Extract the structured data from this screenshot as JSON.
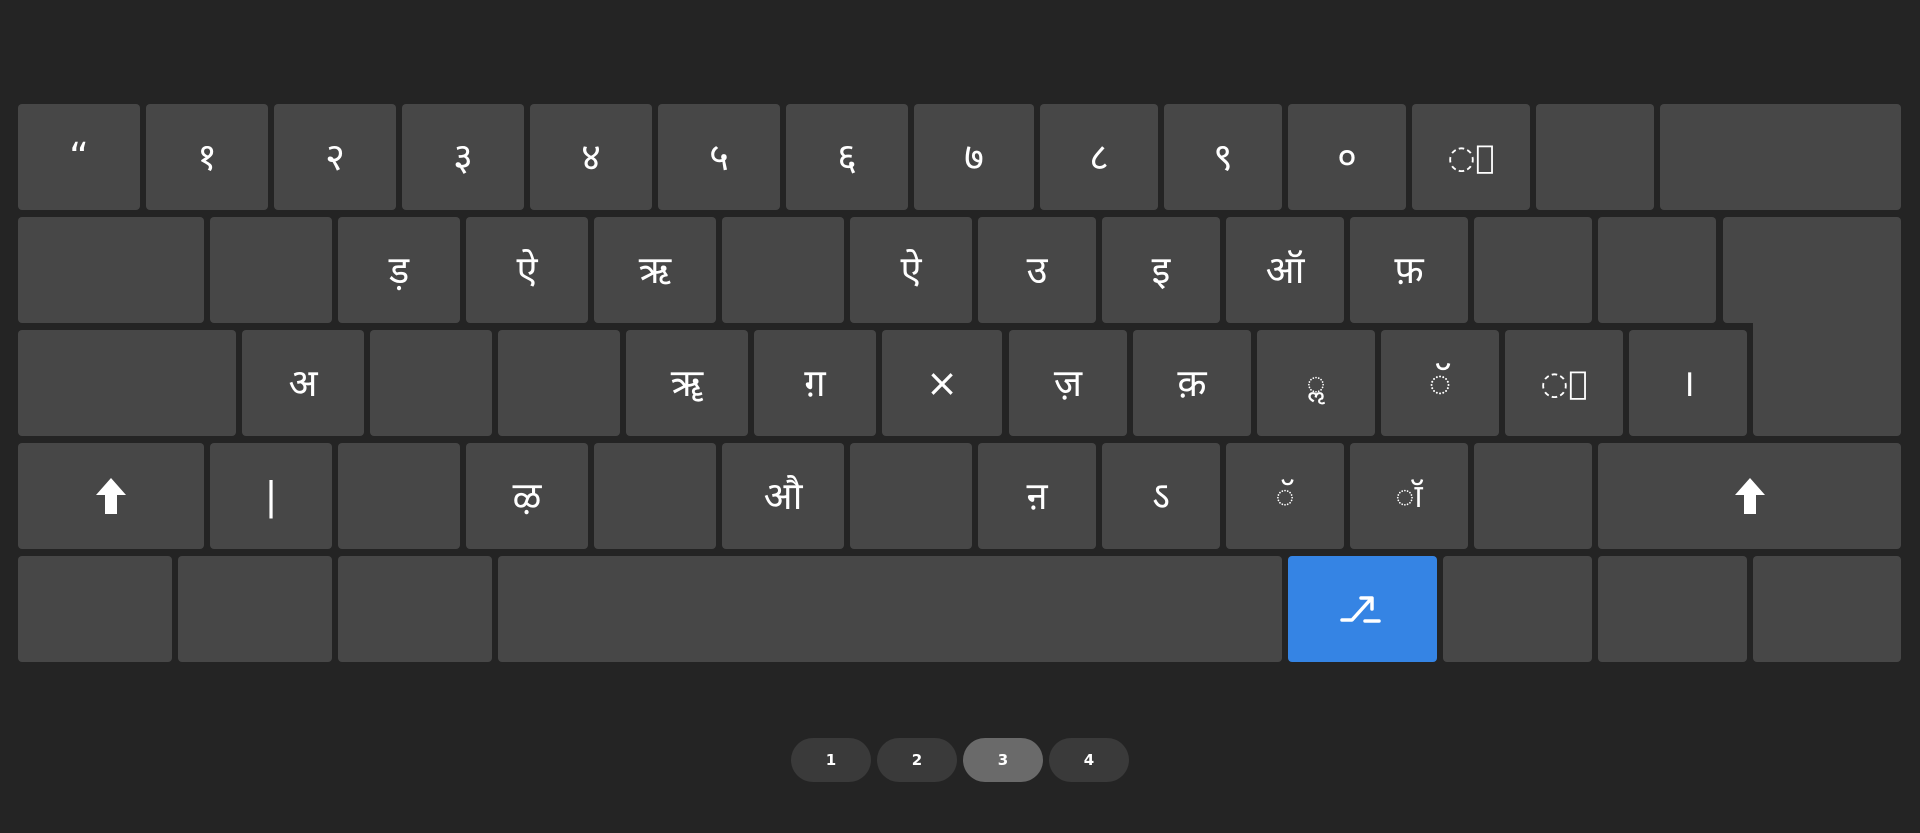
{
  "keyboard": {
    "row1": [
      "“",
      "१",
      "२",
      "३",
      "४",
      "५",
      "६",
      "७",
      "८",
      "९",
      "०",
      "◌॒",
      "",
      ""
    ],
    "row2": [
      "",
      "",
      "ड़",
      "ऐ",
      "ऋ",
      "",
      "ऐ",
      "उ",
      "इ",
      "ऑ",
      "फ़",
      "",
      "",
      ""
    ],
    "row3": [
      "",
      "अ",
      "",
      "",
      "ॠ",
      "ग़",
      "×",
      "ज़",
      "क़",
      "◌ॢ",
      "ॅ",
      "◌॑",
      "।"
    ],
    "row4": [
      "shift-icon",
      "|",
      "",
      "ऴ",
      "",
      "औ",
      "",
      "ऩ",
      "ऽ",
      "◌ॅ",
      "◌ॉ",
      "",
      "shift-icon"
    ],
    "row5": [
      "",
      "",
      "",
      "",
      "switch-layout-icon",
      "",
      "",
      ""
    ]
  },
  "colors": {
    "background": "#242424",
    "key": "#474747",
    "accent": "#3584e4",
    "page_active": "#6a6a6a",
    "page_inactive": "#3a3a3a"
  },
  "pages": {
    "items": [
      "1",
      "2",
      "3",
      "4"
    ],
    "active": "3"
  }
}
